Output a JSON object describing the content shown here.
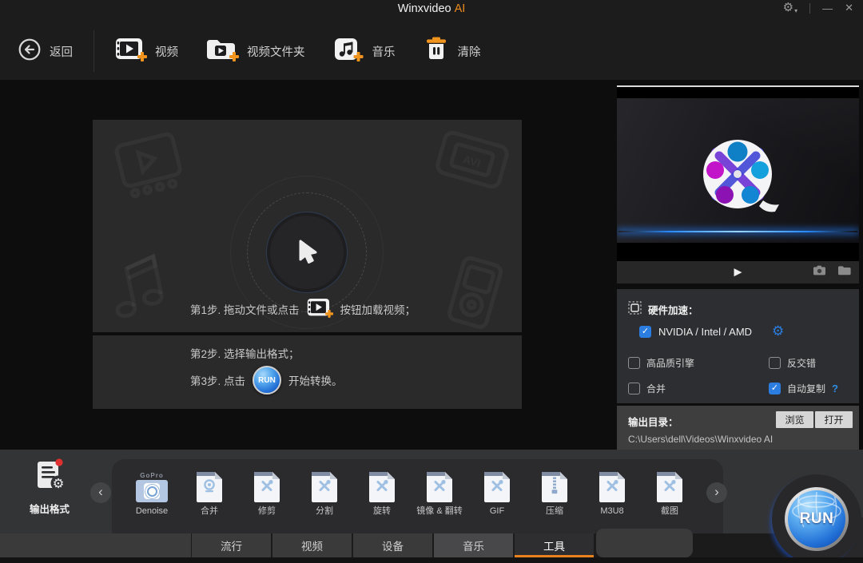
{
  "window": {
    "title": "Winxvideo",
    "title_accent": "AI"
  },
  "icons": {
    "settings": "⚙",
    "caret": "▾",
    "minimize": "—",
    "close": "✕",
    "play": "▶",
    "chevron_left": "‹",
    "chevron_right": "›",
    "check": "✓",
    "help": "?"
  },
  "toolbar": {
    "back": "返回",
    "add_video": "视频",
    "add_video_folder": "视频文件夹",
    "add_music": "音乐",
    "clear": "清除"
  },
  "dropzone": {
    "step1_prefix": "第1步. 拖动文件或点击",
    "step1_suffix": "按钮加载视频；",
    "step2": "第2步. 选择输出格式；",
    "step3_prefix": "第3步. 点击",
    "step3_suffix": "开始转换。",
    "run_label": "RUN"
  },
  "hardware": {
    "title": "硬件加速：",
    "gpu": {
      "label": "NVIDIA / Intel / AMD",
      "checked": true
    },
    "options": [
      {
        "label": "高品质引擎",
        "checked": false,
        "help": false
      },
      {
        "label": "反交错",
        "checked": false,
        "help": false
      },
      {
        "label": "合并",
        "checked": false,
        "help": false
      },
      {
        "label": "自动复制",
        "checked": true,
        "help": true
      }
    ]
  },
  "output": {
    "label": "输出目录：",
    "browse": "浏览",
    "open": "打开",
    "path": "C:\\Users\\dell\\Videos\\Winxvideo AI"
  },
  "formats": {
    "title": "输出格式",
    "items": [
      {
        "label": "Denoise",
        "icon": "gopro",
        "badge": "GoPro"
      },
      {
        "label": "合并",
        "icon": "webcam"
      },
      {
        "label": "修剪",
        "icon": "tools"
      },
      {
        "label": "分割",
        "icon": "tools"
      },
      {
        "label": "旋转",
        "icon": "tools"
      },
      {
        "label": "镜像 & 翻转",
        "icon": "tools"
      },
      {
        "label": "GIF",
        "icon": "tools"
      },
      {
        "label": "压缩",
        "icon": "zip"
      },
      {
        "label": "M3U8",
        "icon": "tools"
      },
      {
        "label": "截图",
        "icon": "tools"
      }
    ]
  },
  "run_button": {
    "label": "RUN"
  },
  "tabs": [
    {
      "label": "流行",
      "state": "normal"
    },
    {
      "label": "视频",
      "state": "normal"
    },
    {
      "label": "设备",
      "state": "normal"
    },
    {
      "label": "音乐",
      "state": "hover"
    },
    {
      "label": "工具",
      "state": "active"
    }
  ],
  "colors": {
    "accent_orange": "#ee8d1d",
    "check_blue": "#2b7de0",
    "run_blue": "#2a6fd8",
    "panel_dark": "#2a2a2b"
  }
}
